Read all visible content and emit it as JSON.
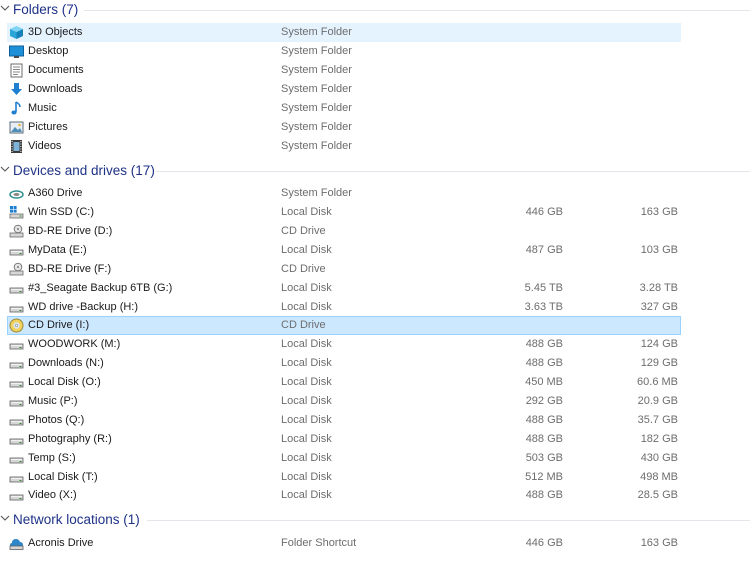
{
  "groups": {
    "folders": {
      "title": "Folders (7)"
    },
    "devices": {
      "title": "Devices and drives (17)"
    },
    "network": {
      "title": "Network locations (1)"
    }
  },
  "folders": [
    {
      "name": "3D Objects",
      "type": "System Folder",
      "icon": "3d-objects-icon"
    },
    {
      "name": "Desktop",
      "type": "System Folder",
      "icon": "desktop-icon"
    },
    {
      "name": "Documents",
      "type": "System Folder",
      "icon": "documents-icon"
    },
    {
      "name": "Downloads",
      "type": "System Folder",
      "icon": "downloads-icon"
    },
    {
      "name": "Music",
      "type": "System Folder",
      "icon": "music-icon"
    },
    {
      "name": "Pictures",
      "type": "System Folder",
      "icon": "pictures-icon"
    },
    {
      "name": "Videos",
      "type": "System Folder",
      "icon": "videos-icon"
    }
  ],
  "drives": [
    {
      "name": "A360 Drive",
      "type": "System Folder",
      "total": "",
      "free": "",
      "icon": "cloud-drive-icon"
    },
    {
      "name": "Win SSD (C:)",
      "type": "Local Disk",
      "total": "446 GB",
      "free": "163 GB",
      "icon": "windows-drive-icon"
    },
    {
      "name": "BD-RE Drive (D:)",
      "type": "CD Drive",
      "total": "",
      "free": "",
      "icon": "optical-drive-icon"
    },
    {
      "name": "MyData (E:)",
      "type": "Local Disk",
      "total": "487 GB",
      "free": "103 GB",
      "icon": "hard-drive-icon"
    },
    {
      "name": "BD-RE Drive (F:)",
      "type": "CD Drive",
      "total": "",
      "free": "",
      "icon": "optical-drive-icon"
    },
    {
      "name": "#3_Seagate Backup 6TB (G:)",
      "type": "Local Disk",
      "total": "5.45 TB",
      "free": "3.28 TB",
      "icon": "hard-drive-icon"
    },
    {
      "name": "WD drive -Backup (H:)",
      "type": "Local Disk",
      "total": "3.63 TB",
      "free": "327 GB",
      "icon": "hard-drive-icon"
    },
    {
      "name": "CD Drive (I:)",
      "type": "CD Drive",
      "total": "",
      "free": "",
      "icon": "cd-disc-icon"
    },
    {
      "name": "WOODWORK (M:)",
      "type": "Local Disk",
      "total": "488 GB",
      "free": "124 GB",
      "icon": "hard-drive-icon"
    },
    {
      "name": "Downloads (N:)",
      "type": "Local Disk",
      "total": "488 GB",
      "free": "129 GB",
      "icon": "hard-drive-icon"
    },
    {
      "name": "Local Disk (O:)",
      "type": "Local Disk",
      "total": "450 MB",
      "free": "60.6 MB",
      "icon": "hard-drive-icon"
    },
    {
      "name": "Music (P:)",
      "type": "Local Disk",
      "total": "292 GB",
      "free": "20.9 GB",
      "icon": "hard-drive-icon"
    },
    {
      "name": "Photos (Q:)",
      "type": "Local Disk",
      "total": "488 GB",
      "free": "35.7 GB",
      "icon": "hard-drive-icon"
    },
    {
      "name": "Photography (R:)",
      "type": "Local Disk",
      "total": "488 GB",
      "free": "182 GB",
      "icon": "hard-drive-icon"
    },
    {
      "name": "Temp (S:)",
      "type": "Local Disk",
      "total": "503 GB",
      "free": "430 GB",
      "icon": "hard-drive-icon"
    },
    {
      "name": "Local Disk (T:)",
      "type": "Local Disk",
      "total": "512 MB",
      "free": "498 MB",
      "icon": "hard-drive-icon"
    },
    {
      "name": "Video (X:)",
      "type": "Local Disk",
      "total": "488 GB",
      "free": "28.5 GB",
      "icon": "hard-drive-icon"
    }
  ],
  "network": [
    {
      "name": "Acronis Drive",
      "type": "Folder Shortcut",
      "total": "446 GB",
      "free": "163 GB",
      "icon": "acronis-drive-icon"
    }
  ],
  "colors": {
    "group_title": "#1e3287",
    "selected_bg": "#cce8ff",
    "selected_border": "#99d1ff",
    "hover_bg": "#e5f3ff"
  }
}
